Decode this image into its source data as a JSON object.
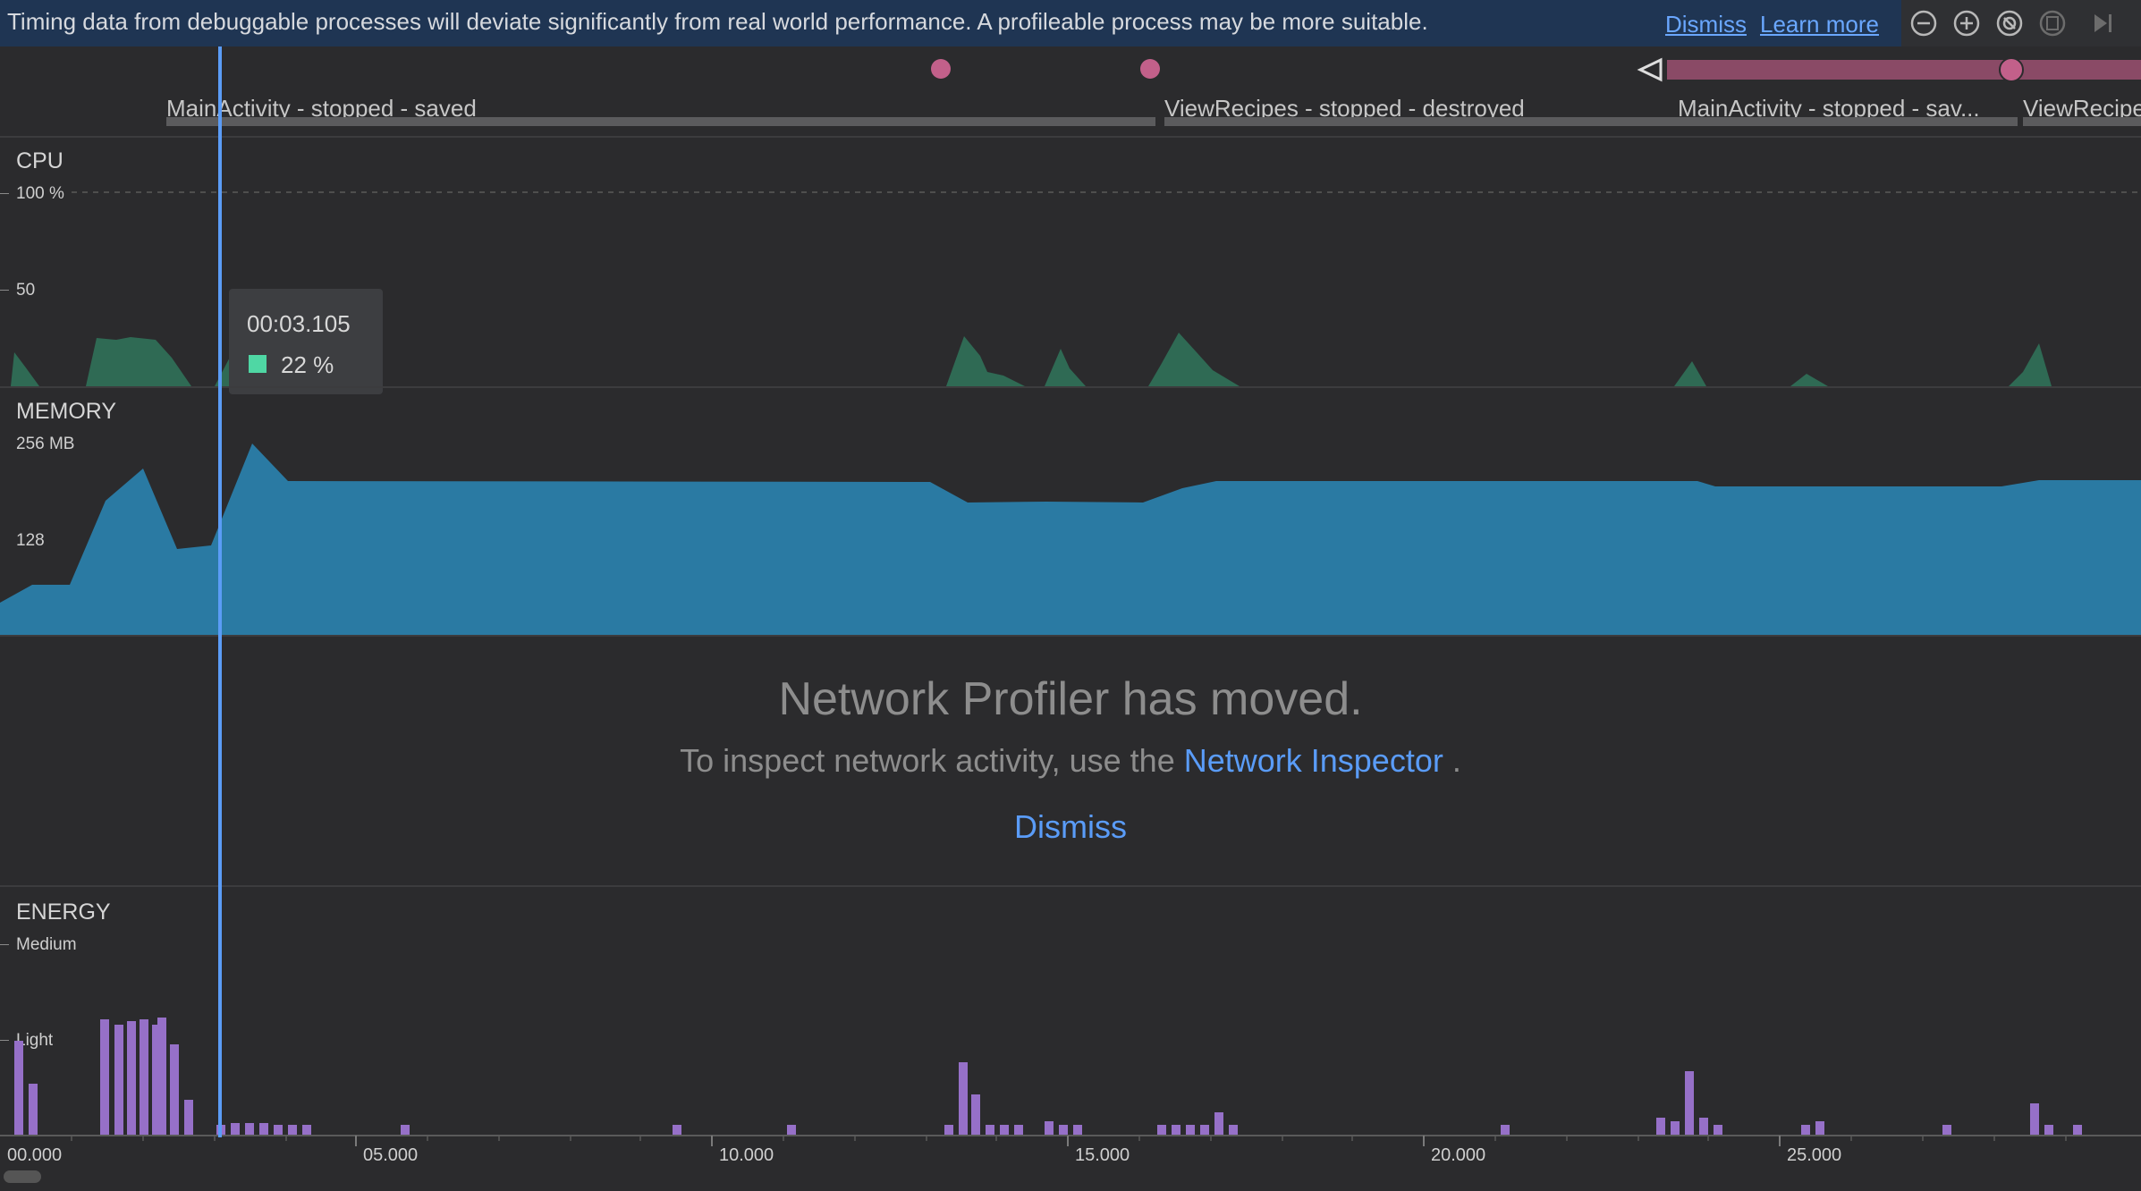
{
  "banner": {
    "message": "Timing data from debuggable processes will deviate significantly from real world performance. A profileable process may be more suitable.",
    "dismiss": "Dismiss",
    "learn_more": "Learn more"
  },
  "toolbar": {
    "zoom_out": "zoom-out-icon",
    "zoom_in": "zoom-in-icon",
    "reset_zoom": "reset-zoom-icon",
    "pause": "pause-icon",
    "jump_to_live": "jump-to-live-icon"
  },
  "lifecycle": [
    "MainActivity - stopped - saved",
    "ViewRecipes - stopped - destroyed",
    "MainActivity - stopped - sav...",
    "ViewRecipe"
  ],
  "cpu": {
    "label": "CPU",
    "axis_top": "100 %",
    "axis_mid": "50"
  },
  "memory": {
    "label": "MEMORY",
    "axis_top": "256 MB",
    "axis_mid": "128"
  },
  "tooltip": {
    "time": "00:03.105",
    "value": "22 %"
  },
  "network": {
    "title": "Network Profiler has moved.",
    "sub_prefix": "To inspect network activity, use the ",
    "link": "Network Inspector",
    "sub_suffix": " .",
    "dismiss": "Dismiss"
  },
  "energy": {
    "label": "ENERGY",
    "axis_top": "Medium",
    "axis_mid": "Light"
  },
  "timeline": [
    "00.000",
    "05.000",
    "10.000",
    "15.000",
    "20.000",
    "25.000"
  ],
  "colors": {
    "banner_bg": "#1f3553",
    "cpu_fill": "#2f6a54",
    "memory_fill": "#2a7aa3",
    "energy_bar": "#9670c8",
    "cursor": "#5b9cf6",
    "lifecycle_marker": "#c2608a",
    "tooltip_swatch": "#4fd7a4"
  }
}
